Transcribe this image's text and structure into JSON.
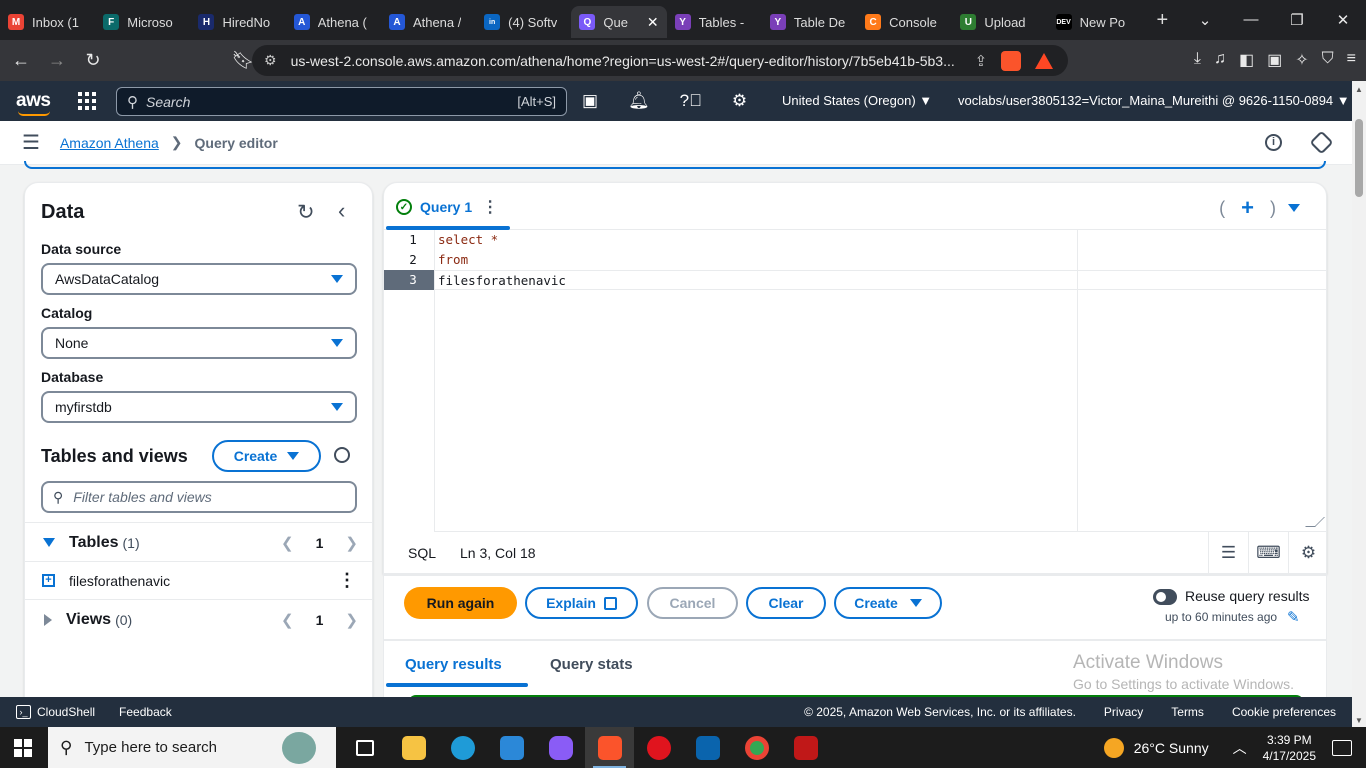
{
  "browser": {
    "tabs": [
      {
        "title": "Inbox (1",
        "icon": "gmail-icon",
        "color": "#ea4335",
        "glyph": "M"
      },
      {
        "title": "Microso",
        "icon": "forms-icon",
        "color": "#0b6a6a",
        "glyph": "F"
      },
      {
        "title": "HiredNo",
        "icon": "hired-icon",
        "color": "#1a2a6c",
        "glyph": "H"
      },
      {
        "title": "Athena (",
        "icon": "athena-icon",
        "color": "#2457d6",
        "glyph": "A"
      },
      {
        "title": "Athena /",
        "icon": "athena-icon",
        "color": "#2457d6",
        "glyph": "A"
      },
      {
        "title": "(4) Softv",
        "icon": "linkedin-icon",
        "color": "#0a66c2",
        "glyph": "in"
      },
      {
        "title": "Que",
        "icon": "query-icon",
        "color": "#7a5af8",
        "glyph": "Q",
        "active": true
      },
      {
        "title": "Tables -",
        "icon": "tables-icon",
        "color": "#7a3fb8",
        "glyph": "Y"
      },
      {
        "title": "Table De",
        "icon": "table-def-icon",
        "color": "#7a3fb8",
        "glyph": "Y"
      },
      {
        "title": "Console",
        "icon": "console-icon",
        "color": "#ff7a1a",
        "glyph": "C"
      },
      {
        "title": "Upload",
        "icon": "upload-icon",
        "color": "#2e7d32",
        "glyph": "U"
      },
      {
        "title": "New Po",
        "icon": "dev-icon",
        "color": "#000000",
        "glyph": "DEV"
      }
    ],
    "url": "us-west-2.console.aws.amazon.com/athena/home?region=us-west-2#/query-editor/history/7b5eb41b-5b3..."
  },
  "aws_nav": {
    "logo": "aws",
    "search_placeholder": "Search",
    "search_shortcut": "[Alt+S]",
    "region": "United States (Oregon) ▼",
    "account": "voclabs/user3805132=Victor_Maina_Mureithi @ 9626-1150-0894 ▼"
  },
  "breadcrumb": {
    "service": "Amazon Athena",
    "current": "Query editor"
  },
  "data_panel": {
    "title": "Data",
    "data_source_label": "Data source",
    "data_source_value": "AwsDataCatalog",
    "catalog_label": "Catalog",
    "catalog_value": "None",
    "database_label": "Database",
    "database_value": "myfirstdb",
    "tables_views_title": "Tables and views",
    "create_label": "Create",
    "filter_placeholder": "Filter tables and views",
    "tables_label": "Tables",
    "tables_count": "(1)",
    "tables_page": "1",
    "table_items": [
      "filesforathenavic"
    ],
    "views_label": "Views",
    "views_count": "(0)",
    "views_page": "1"
  },
  "editor": {
    "tab_label": "Query 1",
    "line_numbers": [
      "1",
      "2",
      "3"
    ],
    "lines": [
      "select *",
      "from",
      "filesforathenavic"
    ],
    "language": "SQL",
    "cursor": "Ln 3, Col 18"
  },
  "actions": {
    "run": "Run again",
    "explain": "Explain",
    "cancel": "Cancel",
    "clear": "Clear",
    "create": "Create",
    "reuse_label": "Reuse query results",
    "reuse_sub": "up to 60 minutes ago"
  },
  "results": {
    "tab_results": "Query results",
    "tab_stats": "Query stats"
  },
  "watermark": {
    "line1": "Activate Windows",
    "line2": "Go to Settings to activate Windows."
  },
  "footer": {
    "cloudshell": "CloudShell",
    "feedback": "Feedback",
    "copyright": "© 2025, Amazon Web Services, Inc. or its affiliates.",
    "privacy": "Privacy",
    "terms": "Terms",
    "cookies": "Cookie preferences"
  },
  "taskbar": {
    "search_placeholder": "Type here to search",
    "weather": "26°C  Sunny",
    "time": "3:39 PM",
    "date": "4/17/2025"
  },
  "colors": {
    "aws_nav": "#232f3e",
    "link_blue": "#0972d3",
    "primary_orange": "#ff9900",
    "success_green": "#037f0c"
  }
}
